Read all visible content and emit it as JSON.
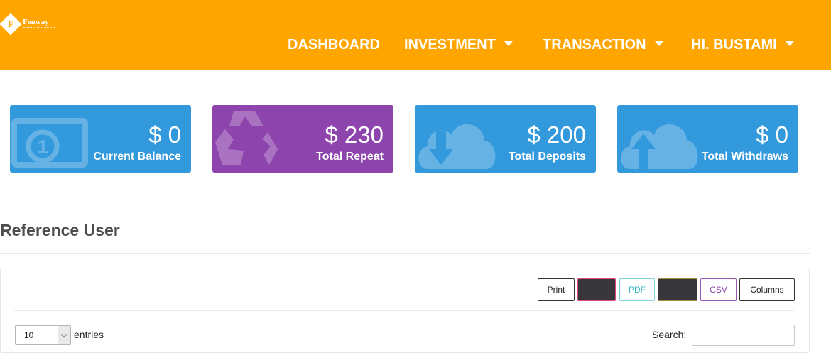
{
  "brand": {
    "name": "Fenway"
  },
  "nav": {
    "dashboard": "DASHBOARD",
    "investment": "INVESTMENT",
    "transaction": "TRANSACTION",
    "user": "HI. BUSTAMI"
  },
  "stats": [
    {
      "amount": "$ 0",
      "label": "Current Balance",
      "color": "#3399dd",
      "icon": "money-icon"
    },
    {
      "amount": "$ 230",
      "label": "Total Repeat",
      "color": "#8e44ad",
      "icon": "recycle-icon"
    },
    {
      "amount": "$ 200",
      "label": "Total Deposits",
      "color": "#3399dd",
      "icon": "cloud-download-icon"
    },
    {
      "amount": "$ 0",
      "label": "Total Withdraws",
      "color": "#3399dd",
      "icon": "cloud-upload-icon"
    }
  ],
  "section": {
    "title": "Reference User"
  },
  "table_tools": {
    "print": "Print",
    "pdf": "PDF",
    "csv": "CSV",
    "columns": "Columns"
  },
  "entries": {
    "value": "10",
    "label": "entries"
  },
  "search": {
    "label": "Search:",
    "value": ""
  },
  "colors": {
    "header": "#ffa500",
    "blue": "#3399dd",
    "purple": "#8e44ad"
  }
}
